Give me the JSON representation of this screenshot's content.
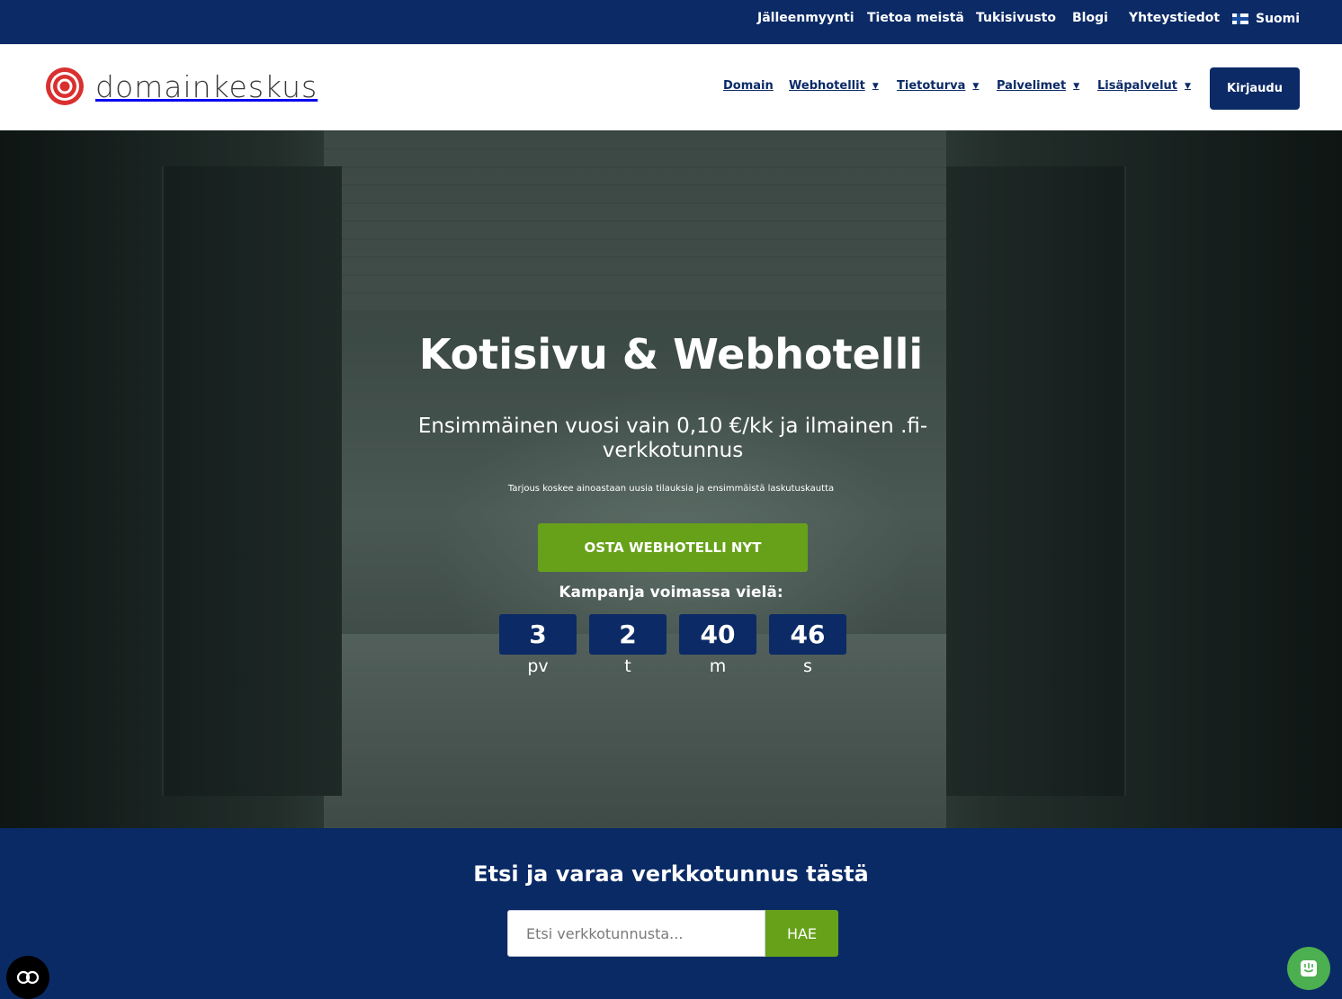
{
  "topbar": {
    "links": [
      "Jälleenmyynti",
      "Tietoa meistä",
      "Tukisivusto",
      "Blogi",
      "Yhteystiedot"
    ],
    "language": "Suomi"
  },
  "header": {
    "logo_text": "domainkeskus",
    "nav": [
      {
        "label": "Domain",
        "has_dropdown": false
      },
      {
        "label": "Webhotellit",
        "has_dropdown": true
      },
      {
        "label": "Tietoturva",
        "has_dropdown": true
      },
      {
        "label": "Palvelimet",
        "has_dropdown": true
      },
      {
        "label": "Lisäpalvelut",
        "has_dropdown": true
      }
    ],
    "login_label": "Kirjaudu"
  },
  "hero": {
    "title": "Kotisivu & Webhotelli",
    "subtitle": "Ensimmäinen vuosi vain 0,10 €/kk ja ilmainen .fi-verkkotunnus",
    "note": "Tarjous koskee ainoastaan uusia tilauksia ja ensimmäistä laskutuskautta",
    "cta_label": "OSTA WEBHOTELLI NYT",
    "campaign_label": "Kampanja voimassa vielä:",
    "countdown": [
      {
        "value": "3",
        "unit": "pv"
      },
      {
        "value": "2",
        "unit": "t"
      },
      {
        "value": "40",
        "unit": "m"
      },
      {
        "value": "46",
        "unit": "s"
      }
    ]
  },
  "search": {
    "title": "Etsi ja varaa verkkotunnus tästä",
    "placeholder": "Etsi verkkotunnusta...",
    "button_label": "HAE"
  },
  "colors": {
    "navy": "#0b2a66",
    "green": "#67a11a",
    "chat_green": "#4caf50",
    "logo_red": "#d9302f"
  }
}
